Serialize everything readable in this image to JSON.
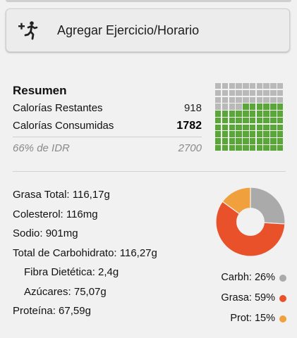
{
  "colors": {
    "consumed": "#5ba639",
    "remaining": "#b9b9b9",
    "carbs": "#aaaaaa",
    "fat": "#e8512a",
    "protein": "#f0a13d"
  },
  "add_button": {
    "icon": "add-exercise-icon",
    "label": "Agregar Ejercicio/Horario"
  },
  "summary": {
    "title": "Resumen",
    "remaining_label": "Calorías Restantes",
    "remaining_value": "918",
    "consumed_label": "Calorías Consumidas",
    "consumed_value": "1782",
    "idr_label": "66% de IDR",
    "idr_value": "2700",
    "waffle_consumed_fraction": 0.66
  },
  "nutrients": {
    "fat": "Grasa Total: 116,17g",
    "cholesterol": "Colesterol: 116mg",
    "sodium": "Sodio: 901mg",
    "carbs": "Total de Carbohidrato: 116,27g",
    "fiber": "Fibra Dietética: 2,4g",
    "sugars": "Azúcares: 75,07g",
    "protein": "Proteína: 67,59g"
  },
  "macros": {
    "carbs": {
      "label": "Carbh: 26%",
      "percent": 26
    },
    "fat": {
      "label": "Grasa: 59%",
      "percent": 59
    },
    "protein": {
      "label": "Prot: 15%",
      "percent": 15
    }
  }
}
